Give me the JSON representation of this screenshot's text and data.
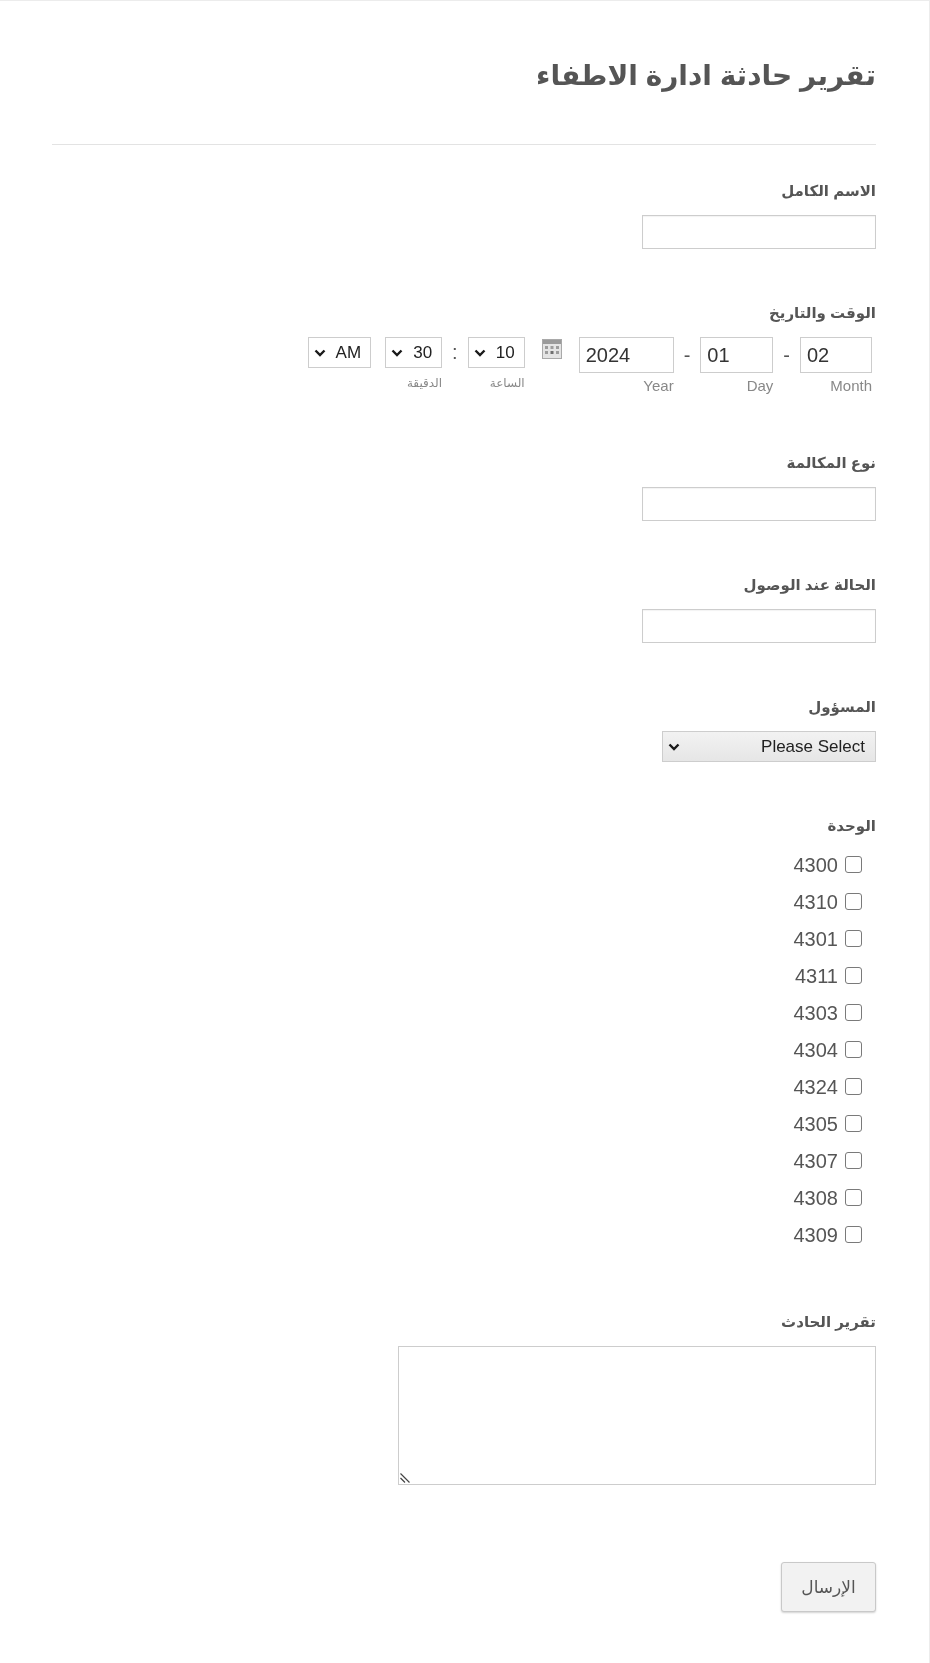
{
  "form": {
    "title": "تقرير حادثة ادارة الاطفاء"
  },
  "fields": [
    {
      "kind": "text",
      "label": "الاسم الكامل"
    },
    {
      "kind": "datetime",
      "label": "الوقت والتاريخ",
      "date_parts": [
        {
          "value": "02",
          "sublabel": "Month",
          "separator": "-"
        },
        {
          "value": "01",
          "sublabel": "Day",
          "separator": "-"
        },
        {
          "value": "2024",
          "sublabel": "Year"
        }
      ],
      "time_parts": [
        {
          "value": "10",
          "sublabel": "الساعة",
          "separator": ":"
        },
        {
          "value": "30",
          "sublabel": "الدقيقة"
        },
        {
          "value": "AM"
        }
      ]
    },
    {
      "kind": "text",
      "label": "نوع المكالمة"
    },
    {
      "kind": "text",
      "label": "الحالة عند الوصول"
    },
    {
      "kind": "select",
      "label": "المسؤول",
      "value": "Please Select"
    },
    {
      "kind": "checkboxes",
      "label": "الوحدة",
      "options": [
        {
          "label": "4300",
          "checked": false
        },
        {
          "label": "4310",
          "checked": false
        },
        {
          "label": "4301",
          "checked": false
        },
        {
          "label": "4311",
          "checked": false
        },
        {
          "label": "4303",
          "checked": false
        },
        {
          "label": "4304",
          "checked": false
        },
        {
          "label": "4324",
          "checked": false
        },
        {
          "label": "4305",
          "checked": false
        },
        {
          "label": "4307",
          "checked": false
        },
        {
          "label": "4308",
          "checked": false
        },
        {
          "label": "4309",
          "checked": false
        }
      ]
    },
    {
      "kind": "textarea",
      "label": "تقرير الحادث"
    }
  ],
  "submit": {
    "label": "الإرسال"
  }
}
